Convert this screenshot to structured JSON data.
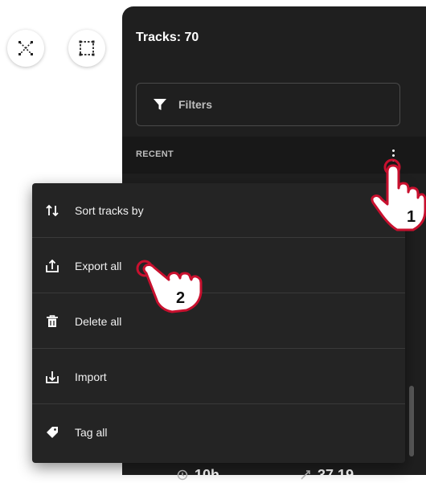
{
  "panel": {
    "title": "Tracks: 70",
    "filter_label": "Filters",
    "section_label": "RECENT"
  },
  "menu": {
    "items": [
      {
        "label": "Sort tracks by",
        "icon": "sort-icon"
      },
      {
        "label": "Export all",
        "icon": "export-icon"
      },
      {
        "label": "Delete all",
        "icon": "trash-icon"
      },
      {
        "label": "Import",
        "icon": "import-icon"
      },
      {
        "label": "Tag all",
        "icon": "tag-icon"
      }
    ]
  },
  "steps": {
    "step1": "1",
    "step2": "2"
  },
  "bottom_stats": {
    "left": "10h",
    "right": "37.19"
  },
  "colors": {
    "panel_bg": "#1f1f1f",
    "menu_bg": "#242424",
    "hand_outline": "#c8102e"
  }
}
